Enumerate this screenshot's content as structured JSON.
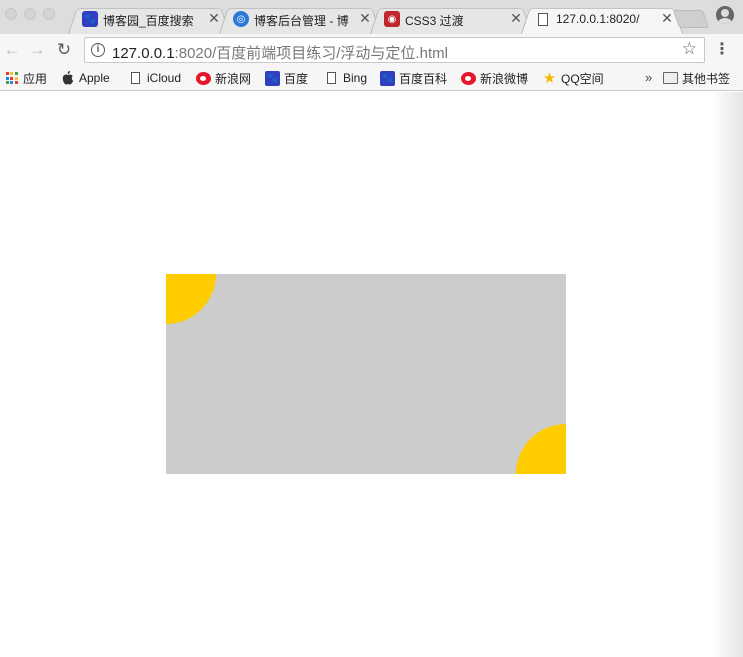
{
  "tabs": [
    {
      "title": "博客园_百度搜索",
      "favicon": "baidu-paw-icon",
      "favicon_color": "#2f3fbf",
      "active": false
    },
    {
      "title": "博客后台管理 - 博",
      "favicon": "cnblogs-icon",
      "favicon_color": "#2b78d6",
      "active": false
    },
    {
      "title": "CSS3 过渡",
      "favicon": "runoob-icon",
      "favicon_color": "#c0262c",
      "active": false
    },
    {
      "title": "127.0.0.1:8020/",
      "favicon": "page-icon",
      "favicon_color": "#ffffff",
      "active": true
    }
  ],
  "tab_close_glyph": "✕",
  "address_bar": {
    "host": "127.0.0.1",
    "rest": ":8020/百度前端项目练习/浮动与定位.html"
  },
  "bookmarks": [
    {
      "label": "应用",
      "icon": "apps-grid-icon"
    },
    {
      "label": "Apple",
      "icon": "apple-icon"
    },
    {
      "label": "iCloud",
      "icon": "page-icon"
    },
    {
      "label": "新浪网",
      "icon": "weibo-icon"
    },
    {
      "label": "百度",
      "icon": "baidu-paw-icon"
    },
    {
      "label": "Bing",
      "icon": "page-icon"
    },
    {
      "label": "百度百科",
      "icon": "baidu-paw-icon"
    },
    {
      "label": "新浪微博",
      "icon": "weibo-icon"
    },
    {
      "label": "QQ空间",
      "icon": "qq-star-icon"
    }
  ],
  "overflow_chevron": "»",
  "other_bookmarks": "其他书签",
  "colors": {
    "box_background": "#cccccc",
    "corner_circles": "#ffcc00"
  }
}
